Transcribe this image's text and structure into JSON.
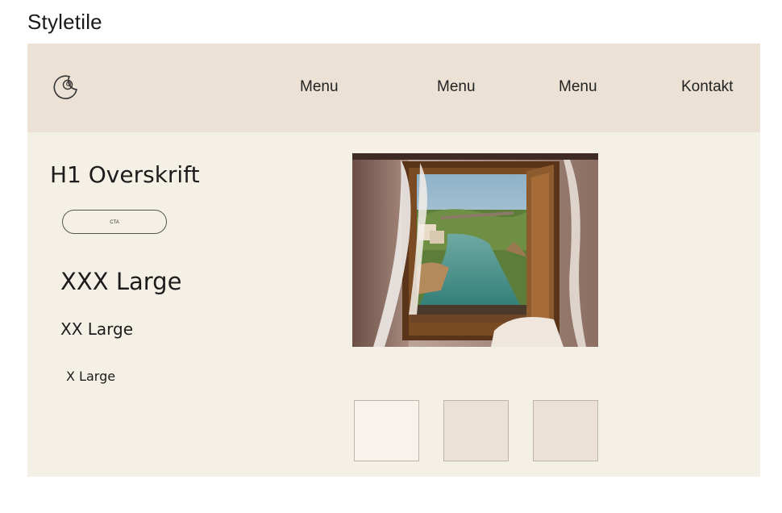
{
  "title": "Styletile",
  "header": {
    "logo_icon": "crescent-moon-logo-icon",
    "nav": [
      "Menu",
      "Menu",
      "Menu",
      "Kontakt"
    ]
  },
  "typography": {
    "h1": "H1 Overskrift",
    "cta_label": "CTA",
    "xxx_large": "XXX Large",
    "xx_large": "XX Large",
    "x_large": "X Large"
  },
  "image": {
    "subject": "window-view-river-photo"
  },
  "colors": {
    "background": "#f5f0e6",
    "header": "#ebe2d5",
    "swatches": [
      "#f7f3ec",
      "#ebe2d5",
      "#ebe2d5"
    ]
  }
}
